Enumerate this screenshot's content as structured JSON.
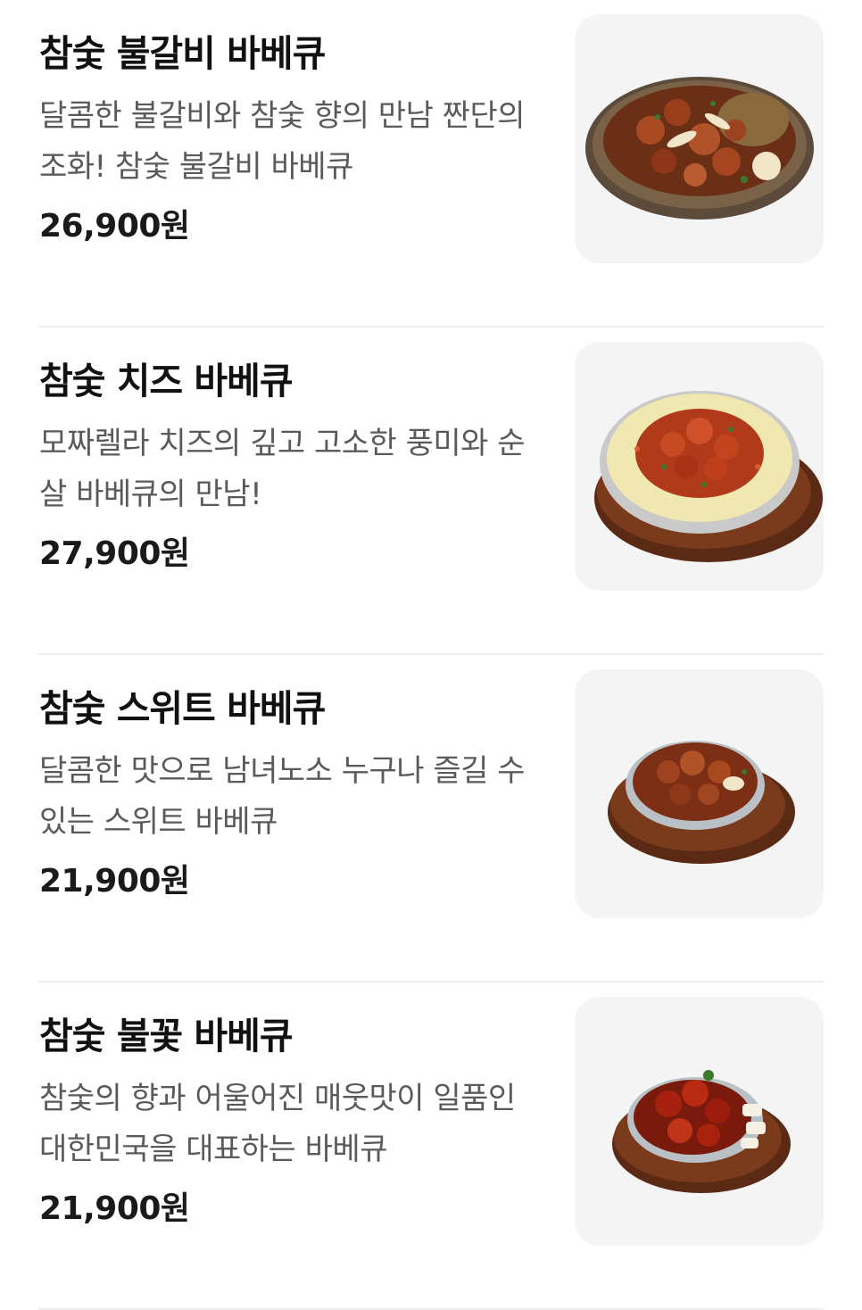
{
  "menu": {
    "items": [
      {
        "name": "참숯 불갈비 바베큐",
        "description": "달콤한 불갈비와 참숯 향의 만남 짠단의 조화! 참숯 불갈비 바베큐",
        "price": "26,900원",
        "image_icon": "grilled-galbi-dish-icon"
      },
      {
        "name": "참숯 치즈 바베큐",
        "description": "모짜렐라 치즈의 깊고 고소한 풍미와 순살 바베큐의 만남!",
        "price": "27,900원",
        "image_icon": "cheese-bbq-dish-icon"
      },
      {
        "name": "참숯 스위트 바베큐",
        "description": "달콤한 맛으로 남녀노소 누구나 즐길 수 있는 스위트 바베큐",
        "price": "21,900원",
        "image_icon": "sweet-bbq-dish-icon"
      },
      {
        "name": "참숯 불꽃 바베큐",
        "description": "참숯의 향과 어울어진 매웃맛이 일품인 대한민국을 대표하는 바베큐",
        "price": "21,900원",
        "image_icon": "spicy-bbq-dish-icon"
      }
    ]
  }
}
